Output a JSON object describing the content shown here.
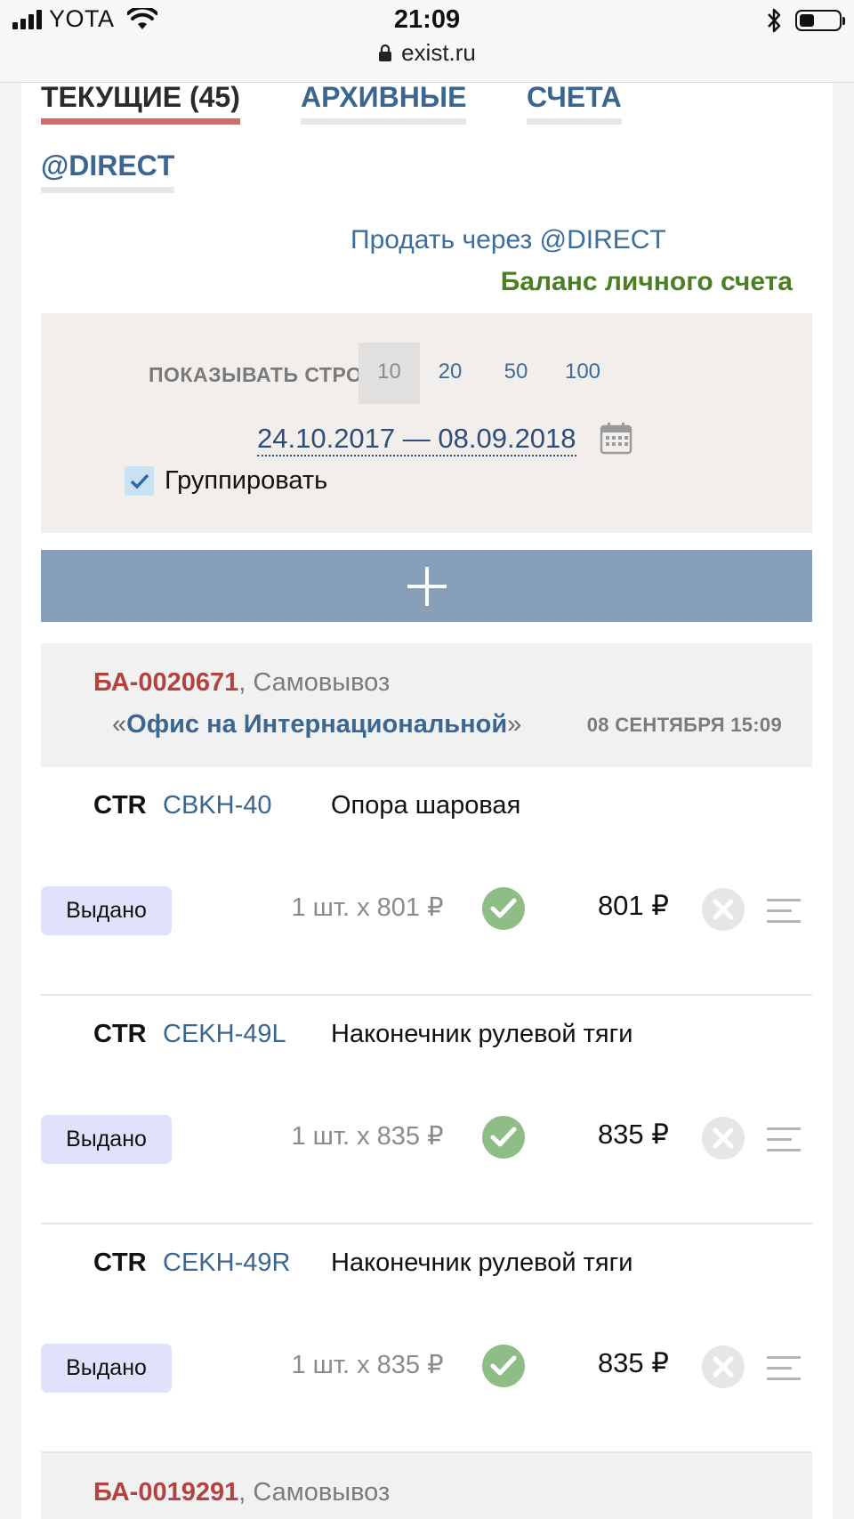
{
  "status_bar": {
    "carrier": "YOTA",
    "time": "21:09",
    "url": "exist.ru"
  },
  "tabs": [
    {
      "label": "ТЕКУЩИЕ (45)",
      "active": true
    },
    {
      "label": "АРХИВНЫЕ",
      "active": false
    },
    {
      "label": "СЧЕТА",
      "active": false
    },
    {
      "label": "@DIRECT",
      "active": false
    }
  ],
  "sell_direct_link": "Продать через @DIRECT",
  "balance_link": "Баланс личного счета",
  "filter": {
    "rows_label": "ПОКАЗЫВАТЬ СТРОК:",
    "rows_options": [
      "10",
      "20",
      "50",
      "100"
    ],
    "rows_selected": "10",
    "date_range": "24.10.2017 — 08.09.2018",
    "group_label": "Группировать",
    "group_checked": true
  },
  "orders": [
    {
      "id": "БА-0020671",
      "delivery": ", Самовывоз",
      "office_prefix": "«",
      "office": "Офис на Интернациональной",
      "office_suffix": "»",
      "date": "08 СЕНТЯБРЯ 15:09",
      "items": [
        {
          "brand": "CTR",
          "code": "CBKH-40",
          "name": "Опора шаровая",
          "status": "Выдано",
          "qty": "1 шт. x 801 ₽",
          "price": "801 ₽"
        },
        {
          "brand": "CTR",
          "code": "CEKH-49L",
          "name": "Наконечник рулевой тяги",
          "status": "Выдано",
          "qty": "1 шт. x 835 ₽",
          "price": "835 ₽"
        },
        {
          "brand": "CTR",
          "code": "CEKH-49R",
          "name": "Наконечник рулевой тяги",
          "status": "Выдано",
          "qty": "1 шт. x 835 ₽",
          "price": "835 ₽"
        }
      ]
    },
    {
      "id": "БА-0019291",
      "delivery": ", Самовывоз"
    }
  ],
  "colors": {
    "link": "#3b6690",
    "order_id": "#b24340",
    "balance": "#4a7f23",
    "active_tab_underline": "#d96a68",
    "add_bar": "#879fb9",
    "status_badge": "#e0e1fb",
    "ok_check": "#8fbd86"
  }
}
